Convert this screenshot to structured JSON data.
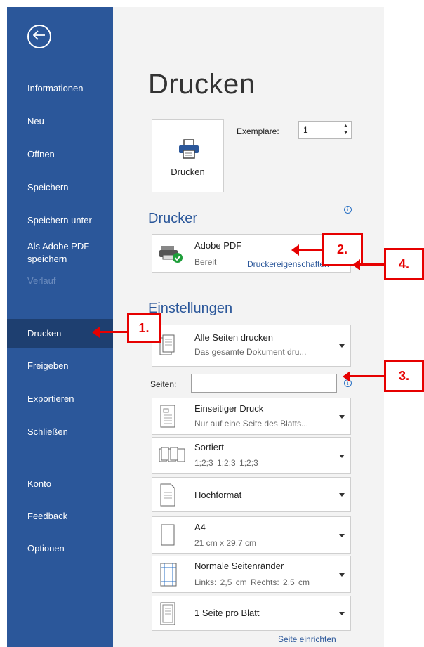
{
  "sidebar": {
    "back_icon": "back-arrow-icon",
    "items": [
      {
        "label": "Informationen"
      },
      {
        "label": "Neu"
      },
      {
        "label": "Öffnen"
      },
      {
        "label": "Speichern"
      },
      {
        "label": "Speichern unter"
      },
      {
        "label": "Als Adobe PDF speichern"
      },
      {
        "label": "Verlauf"
      },
      {
        "label": "Drucken"
      },
      {
        "label": "Freigeben"
      },
      {
        "label": "Exportieren"
      },
      {
        "label": "Schließen"
      },
      {
        "label": "Konto"
      },
      {
        "label": "Feedback"
      },
      {
        "label": "Optionen"
      }
    ]
  },
  "main": {
    "title": "Drucken",
    "print_button": {
      "label": "Drucken",
      "icon": "printer-icon"
    },
    "copies": {
      "label": "Exemplare:",
      "value": "1"
    },
    "printer_section": {
      "heading": "Drucker",
      "printer_name": "Adobe PDF",
      "printer_status": "Bereit",
      "properties_link": "Druckereigenschaften"
    },
    "settings_section": {
      "heading": "Einstellungen",
      "range": {
        "title": "Alle Seiten drucken",
        "subtitle": "Das gesamte Dokument dru..."
      },
      "pages_label": "Seiten:",
      "pages_value": "",
      "sides": {
        "title": "Einseitiger Druck",
        "subtitle": "Nur auf eine Seite des Blatts..."
      },
      "collate": {
        "title": "Sortiert",
        "subtitle": "1;2;3    1;2;3    1;2;3"
      },
      "orientation": {
        "title": "Hochformat"
      },
      "paper": {
        "title": "A4",
        "subtitle": "21 cm x 29,7 cm"
      },
      "margins": {
        "title": "Normale Seitenränder",
        "subtitle": "Links: 2,5 cm    Rechts: 2,5 cm"
      },
      "per_sheet": {
        "title": "1 Seite pro Blatt"
      },
      "page_setup_link": "Seite einrichten"
    }
  },
  "annotations": [
    "1.",
    "2.",
    "3.",
    "4."
  ],
  "colors": {
    "sidebar": "#2b579a",
    "sidebar_active": "#1e3f70",
    "annotation": "#e60000"
  }
}
